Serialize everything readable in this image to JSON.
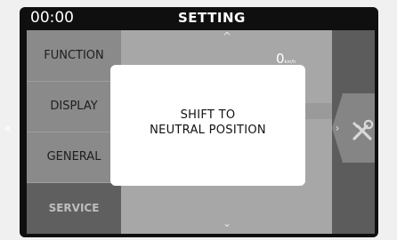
{
  "status": {
    "time": "00:00",
    "title": "SETTING"
  },
  "menu": {
    "items": [
      {
        "label": "FUNCTION"
      },
      {
        "label": "DISPLAY"
      },
      {
        "label": "GENERAL"
      },
      {
        "label": "SERVICE",
        "selected": true
      }
    ]
  },
  "content": {
    "speed_value": "0",
    "speed_unit": "km/h"
  },
  "dialog": {
    "line1": "SHIFT TO",
    "line2": "NEUTRAL POSITION"
  },
  "icons": {
    "up": "chevron-up-icon",
    "down": "chevron-down-icon",
    "back": "double-chevron-left-icon",
    "next": "chevron-right-icon",
    "tools": "wrench-screwdriver-icon"
  },
  "colors": {
    "background": "#0f0f0f",
    "panel": "#8c8c8c",
    "selected": "#5f5f5f",
    "dialog": "#ffffff"
  }
}
